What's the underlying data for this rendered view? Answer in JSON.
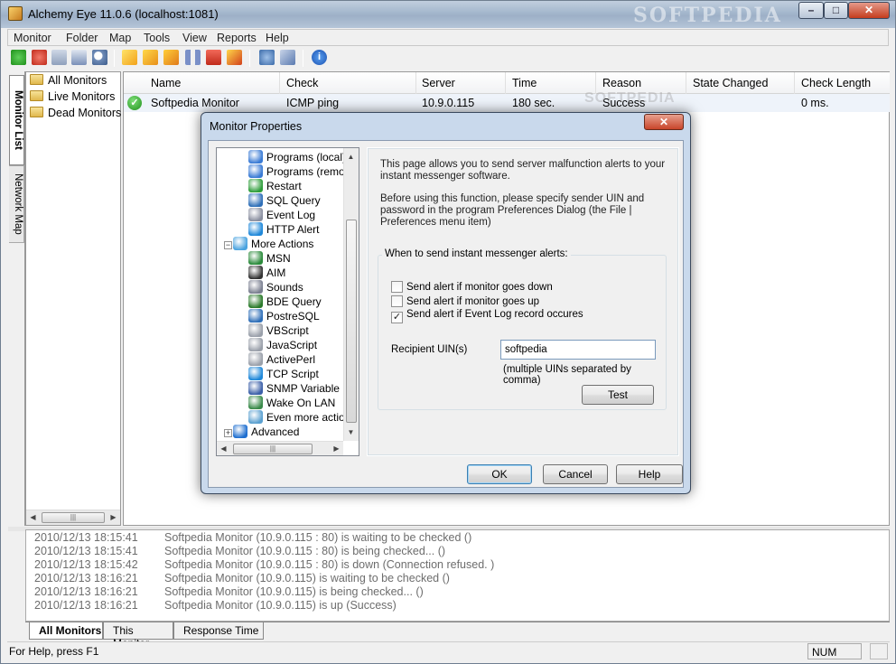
{
  "window": {
    "title": "Alchemy Eye 11.0.6 (localhost:1081)",
    "watermark": "SOFTPEDIA",
    "minimize": "–",
    "maximize": "□",
    "close": "✕"
  },
  "menu": [
    "Monitor",
    "Folder",
    "Map",
    "Tools",
    "View",
    "Reports",
    "Help"
  ],
  "toolbar_icons": [
    "add-monitor-icon",
    "remove-monitor-icon",
    "copy-monitor-icon",
    "properties-icon",
    "find-icon",
    "check-icon",
    "check-all-icon",
    "check-folder-icon",
    "pause-icon",
    "stop-icon",
    "alert-icon",
    "network-icon",
    "settings-icon",
    "info-icon"
  ],
  "side_tabs": {
    "monitor_list": "Monitor List",
    "network_map": "Network Map"
  },
  "tree": [
    "All Monitors",
    "Live Monitors",
    "Dead Monitors"
  ],
  "grid": {
    "columns": [
      "Name",
      "Check",
      "Server",
      "Time",
      "Reason",
      "State Changed",
      "Check Length"
    ],
    "rows": [
      {
        "status": "✓",
        "name": "Softpedia Monitor",
        "check": "ICMP ping",
        "server": "10.9.0.115",
        "time": "180 sec.",
        "reason": "Success",
        "state_changed": "",
        "check_length": "0 ms."
      }
    ],
    "watermark": "SOFTPEDIA"
  },
  "log": [
    {
      "time": "2010/12/13 18:15:41",
      "msg": "Softpedia Monitor (10.9.0.115 : 80) is waiting to be checked ()"
    },
    {
      "time": "2010/12/13 18:15:41",
      "msg": "Softpedia Monitor (10.9.0.115 : 80) is being checked... ()"
    },
    {
      "time": "2010/12/13 18:15:42",
      "msg": "Softpedia Monitor (10.9.0.115 : 80) is down (Connection refused. )"
    },
    {
      "time": "2010/12/13 18:16:21",
      "msg": "Softpedia Monitor (10.9.0.115) is waiting to be checked ()"
    },
    {
      "time": "2010/12/13 18:16:21",
      "msg": "Softpedia Monitor (10.9.0.115) is being checked... ()"
    },
    {
      "time": "2010/12/13 18:16:21",
      "msg": "Softpedia Monitor (10.9.0.115) is up (Success)"
    }
  ],
  "bottom_tabs": [
    "All Monitors",
    "This Monitor",
    "Response Time"
  ],
  "status": {
    "help": "For Help, press F1",
    "num": "NUM"
  },
  "dialog": {
    "title": "Monitor Properties",
    "close": "✕",
    "actions": [
      {
        "label": "Programs (local)",
        "icon": "windows-icon",
        "color": "#3a7bd5"
      },
      {
        "label": "Programs (remote)",
        "icon": "windows-icon",
        "color": "#3a7bd5"
      },
      {
        "label": "Restart",
        "icon": "restart-icon",
        "color": "#2e9d3a"
      },
      {
        "label": "SQL Query",
        "icon": "sql-icon",
        "color": "#2f6fb8"
      },
      {
        "label": "Event Log",
        "icon": "event-log-icon",
        "color": "#8a8fa0"
      },
      {
        "label": "HTTP Alert",
        "icon": "ie-icon",
        "color": "#1f88d9"
      },
      {
        "label": "More Actions",
        "icon": "more-actions-icon",
        "color": "#4aa3df"
      },
      {
        "label": "MSN",
        "icon": "msn-icon",
        "color": "#2a8a3a"
      },
      {
        "label": "AIM",
        "icon": "aim-icon",
        "color": "#333333"
      },
      {
        "label": "Sounds",
        "icon": "sounds-icon",
        "color": "#7a7f90"
      },
      {
        "label": "BDE Query",
        "icon": "bde-icon",
        "color": "#2b7a2b"
      },
      {
        "label": "PostreSQL",
        "icon": "postgresql-icon",
        "color": "#2f6fb8"
      },
      {
        "label": "VBScript",
        "icon": "script-icon",
        "color": "#9aa0aa"
      },
      {
        "label": "JavaScript",
        "icon": "script-icon",
        "color": "#9aa0aa"
      },
      {
        "label": "ActivePerl",
        "icon": "script-icon",
        "color": "#9aa0aa"
      },
      {
        "label": "TCP Script",
        "icon": "ie-icon",
        "color": "#1f88d9"
      },
      {
        "label": "SNMP Variable",
        "icon": "snmp-icon",
        "color": "#3b5fa8"
      },
      {
        "label": "Wake On LAN",
        "icon": "wol-icon",
        "color": "#3a8a4a"
      },
      {
        "label": "Even more actions",
        "icon": "even-more-icon",
        "color": "#5aa0d0"
      },
      {
        "label": "Advanced",
        "icon": "info-icon",
        "color": "#1f6fd0"
      }
    ],
    "text1": "This page allows you to send server malfunction alerts to your instant messenger software.",
    "text2": "Before using this function, please specify sender UIN and password in the program Preferences Dialog (the File | Preferences menu item)",
    "group_label": "When to send instant messenger alerts:",
    "checks": [
      {
        "label": "Send alert if monitor goes down",
        "checked": false
      },
      {
        "label": "Send alert if monitor goes up",
        "checked": false
      },
      {
        "label": "Send alert if Event Log record occures",
        "checked": true
      }
    ],
    "uin_label": "Recipient UIN(s)",
    "uin_value": "softpedia",
    "uin_hint": "(multiple UINs separated by comma)",
    "test": "Test",
    "ok": "OK",
    "cancel": "Cancel",
    "help": "Help"
  }
}
